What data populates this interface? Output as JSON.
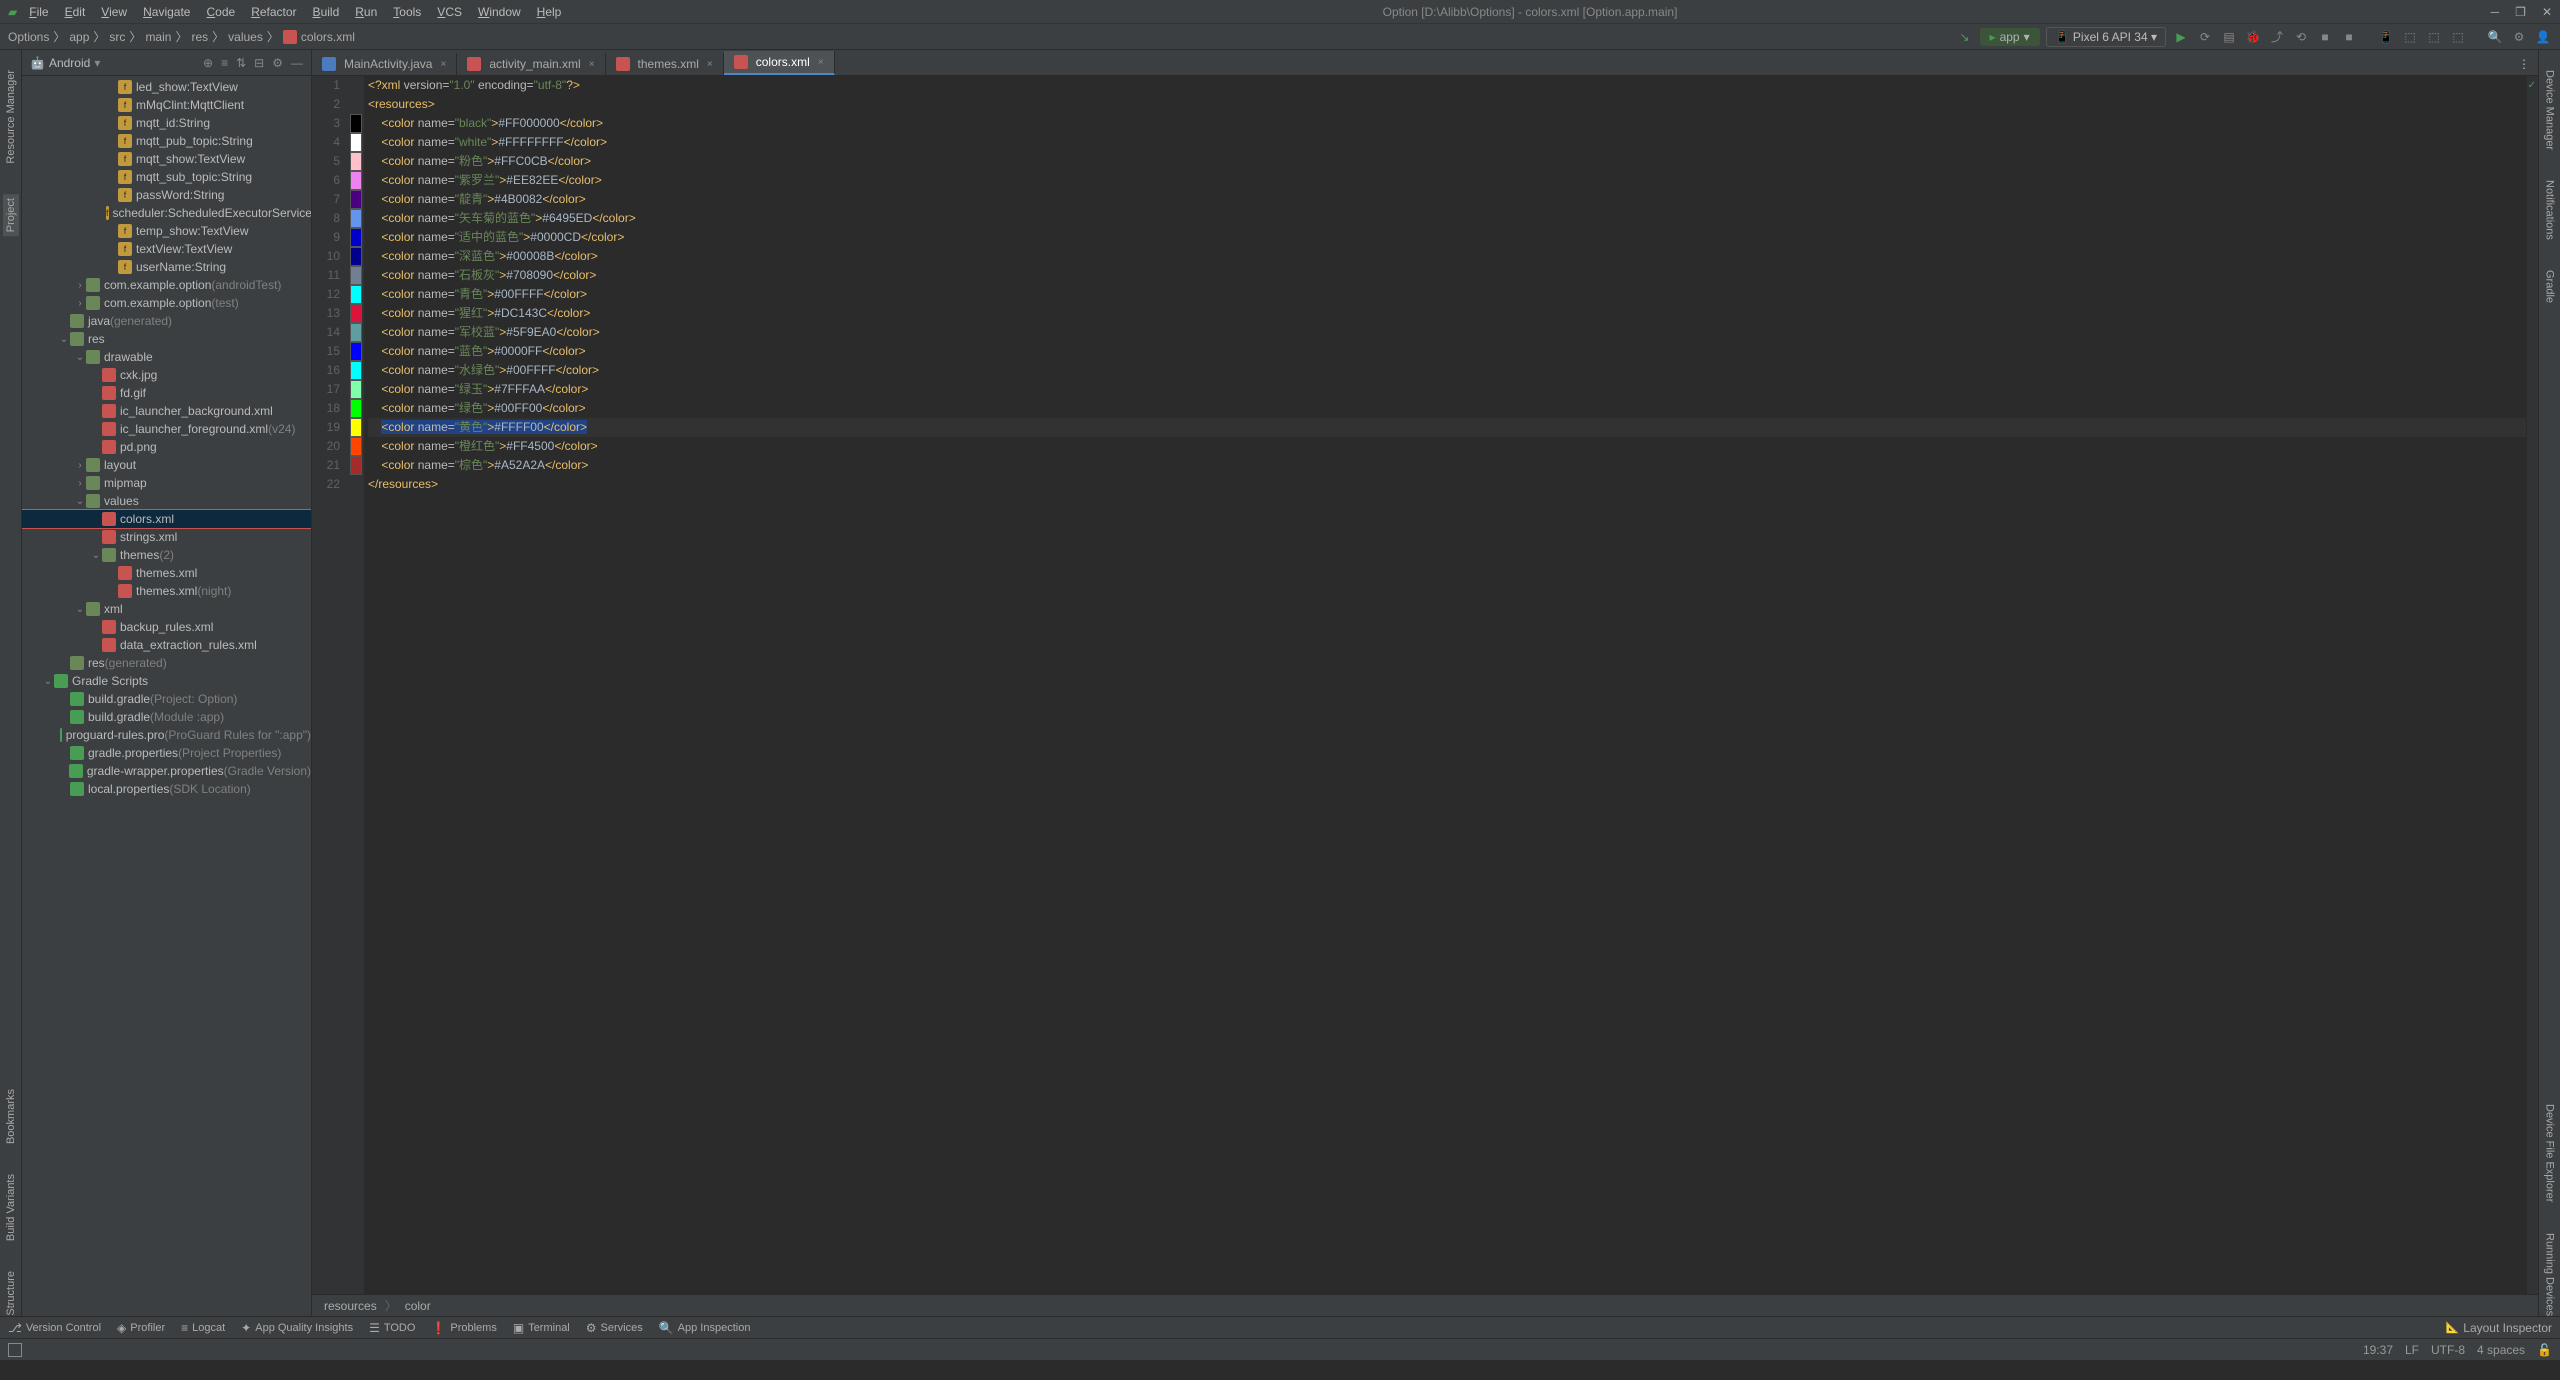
{
  "window": {
    "title": "Option [D:\\Alibb\\Options] - colors.xml [Option.app.main]"
  },
  "menu": [
    "File",
    "Edit",
    "View",
    "Navigate",
    "Code",
    "Refactor",
    "Build",
    "Run",
    "Tools",
    "VCS",
    "Window",
    "Help"
  ],
  "breadcrumb": [
    "Options",
    "app",
    "src",
    "main",
    "res",
    "values",
    "colors.xml"
  ],
  "toolbar": {
    "app": "app",
    "device": "Pixel 6 API 34"
  },
  "sidebar": {
    "mode": "Android",
    "items": [
      {
        "d": 4,
        "i": "f",
        "t": "led_show:TextView"
      },
      {
        "d": 4,
        "i": "f",
        "t": "mMqClint:MqttClient"
      },
      {
        "d": 4,
        "i": "f",
        "t": "mqtt_id:String"
      },
      {
        "d": 4,
        "i": "f",
        "t": "mqtt_pub_topic:String"
      },
      {
        "d": 4,
        "i": "f",
        "t": "mqtt_show:TextView"
      },
      {
        "d": 4,
        "i": "f",
        "t": "mqtt_sub_topic:String"
      },
      {
        "d": 4,
        "i": "f",
        "t": "passWord:String"
      },
      {
        "d": 4,
        "i": "f",
        "t": "scheduler:ScheduledExecutorService"
      },
      {
        "d": 4,
        "i": "f",
        "t": "temp_show:TextView"
      },
      {
        "d": 4,
        "i": "f",
        "t": "textView:TextView"
      },
      {
        "d": 4,
        "i": "f",
        "t": "userName:String"
      },
      {
        "d": 2,
        "c": ">",
        "i": "d",
        "t": "com.example.option",
        "g": "(androidTest)"
      },
      {
        "d": 2,
        "c": ">",
        "i": "d",
        "t": "com.example.option",
        "g": "(test)"
      },
      {
        "d": 1,
        "i": "d",
        "t": "java",
        "g": "(generated)"
      },
      {
        "d": 1,
        "c": "v",
        "i": "d",
        "t": "res"
      },
      {
        "d": 2,
        "c": "v",
        "i": "d",
        "t": "drawable"
      },
      {
        "d": 3,
        "i": "x",
        "t": "cxk.jpg"
      },
      {
        "d": 3,
        "i": "x",
        "t": "fd.gif"
      },
      {
        "d": 3,
        "i": "x",
        "t": "ic_launcher_background.xml"
      },
      {
        "d": 3,
        "i": "x",
        "t": "ic_launcher_foreground.xml",
        "g": "(v24)"
      },
      {
        "d": 3,
        "i": "x",
        "t": "pd.png"
      },
      {
        "d": 2,
        "c": ">",
        "i": "d",
        "t": "layout"
      },
      {
        "d": 2,
        "c": ">",
        "i": "d",
        "t": "mipmap"
      },
      {
        "d": 2,
        "c": "v",
        "i": "d",
        "t": "values"
      },
      {
        "d": 3,
        "i": "x",
        "t": "colors.xml",
        "sel": true
      },
      {
        "d": 3,
        "i": "x",
        "t": "strings.xml"
      },
      {
        "d": 3,
        "c": "v",
        "i": "d",
        "t": "themes",
        "g": "(2)"
      },
      {
        "d": 4,
        "i": "x",
        "t": "themes.xml"
      },
      {
        "d": 4,
        "i": "x",
        "t": "themes.xml",
        "g": "(night)"
      },
      {
        "d": 2,
        "c": "v",
        "i": "d",
        "t": "xml"
      },
      {
        "d": 3,
        "i": "x",
        "t": "backup_rules.xml"
      },
      {
        "d": 3,
        "i": "x",
        "t": "data_extraction_rules.xml"
      },
      {
        "d": 1,
        "i": "d",
        "t": "res",
        "g": "(generated)"
      },
      {
        "d": 0,
        "c": "v",
        "i": "g",
        "t": "Gradle Scripts"
      },
      {
        "d": 1,
        "i": "g",
        "t": "build.gradle",
        "g": "(Project: Option)"
      },
      {
        "d": 1,
        "i": "g",
        "t": "build.gradle",
        "g": "(Module :app)"
      },
      {
        "d": 1,
        "i": "g",
        "t": "proguard-rules.pro",
        "g": "(ProGuard Rules for \":app\")"
      },
      {
        "d": 1,
        "i": "g",
        "t": "gradle.properties",
        "g": "(Project Properties)"
      },
      {
        "d": 1,
        "i": "g",
        "t": "gradle-wrapper.properties",
        "g": "(Gradle Version)"
      },
      {
        "d": 1,
        "i": "g",
        "t": "local.properties",
        "g": "(SDK Location)"
      }
    ]
  },
  "tabs": [
    {
      "label": "MainActivity.java",
      "icon": "j"
    },
    {
      "label": "activity_main.xml",
      "icon": "x"
    },
    {
      "label": "themes.xml",
      "icon": "x"
    },
    {
      "label": "colors.xml",
      "icon": "x",
      "active": true
    }
  ],
  "code": {
    "header": {
      "ver": "\"1.0\"",
      "enc": "\"utf-8\""
    },
    "colors": [
      {
        "name": "black",
        "val": "#FF000000",
        "sw": "#000000"
      },
      {
        "name": "white",
        "val": "#FFFFFFFF",
        "sw": "#FFFFFF"
      },
      {
        "name": "粉色",
        "val": "#FFC0CB",
        "sw": "#FFC0CB"
      },
      {
        "name": "紫罗兰",
        "val": "#EE82EE",
        "sw": "#EE82EE"
      },
      {
        "name": "靛青",
        "val": "#4B0082",
        "sw": "#4B0082"
      },
      {
        "name": "矢车菊的蓝色",
        "val": "#6495ED",
        "sw": "#6495ED"
      },
      {
        "name": "适中的蓝色",
        "val": "#0000CD",
        "sw": "#0000CD"
      },
      {
        "name": "深蓝色",
        "val": "#00008B",
        "sw": "#00008B"
      },
      {
        "name": "石板灰",
        "val": "#708090",
        "sw": "#708090"
      },
      {
        "name": "青色",
        "val": "#00FFFF",
        "sw": "#00FFFF"
      },
      {
        "name": "猩红",
        "val": "#DC143C",
        "sw": "#DC143C"
      },
      {
        "name": "军校蓝",
        "val": "#5F9EA0",
        "sw": "#5F9EA0"
      },
      {
        "name": "蓝色",
        "val": "#0000FF",
        "sw": "#0000FF"
      },
      {
        "name": "水绿色",
        "val": "#00FFFF",
        "sw": "#00FFFF"
      },
      {
        "name": "绿玉",
        "val": "#7FFFAA",
        "sw": "#7FFFAA"
      },
      {
        "name": "绿色",
        "val": "#00FF00",
        "sw": "#00FF00"
      },
      {
        "name": "黄色",
        "val": "#FFFF00",
        "sw": "#FFFF00",
        "cur": true
      },
      {
        "name": "橙红色",
        "val": "#FF4500",
        "sw": "#FF4500"
      },
      {
        "name": "棕色",
        "val": "#A52A2A",
        "sw": "#A52A2A"
      }
    ]
  },
  "ed_bc": [
    "resources",
    "color"
  ],
  "left_rail": [
    "Resource Manager",
    "Project"
  ],
  "right_rail": [
    "Device Manager",
    "Notifications",
    "Gradle",
    "Device File Explorer",
    "Running Devices"
  ],
  "bottom": [
    "Version Control",
    "Profiler",
    "Logcat",
    "App Quality Insights",
    "TODO",
    "Problems",
    "Terminal",
    "Services",
    "App Inspection"
  ],
  "status": {
    "layout": "Layout Inspector",
    "pos": "19:37",
    "lf": "LF",
    "enc": "UTF-8",
    "sp": "4 spaces"
  }
}
